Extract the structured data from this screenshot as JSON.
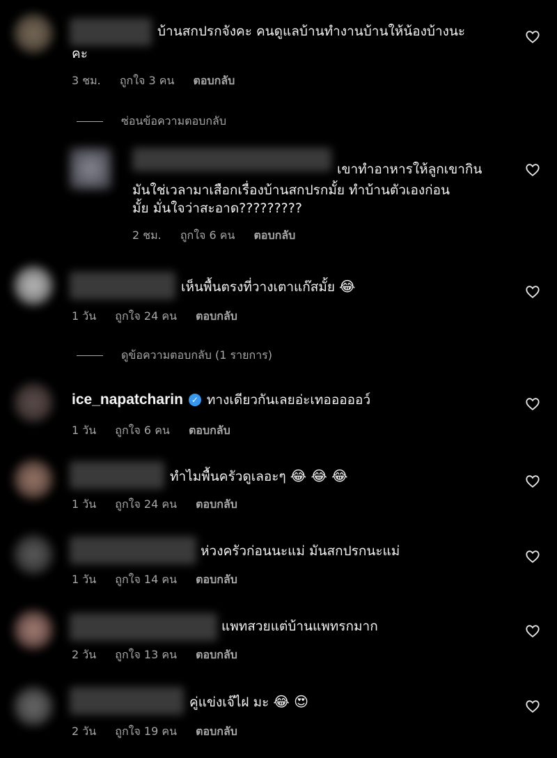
{
  "icons": {
    "heart": "heart-outline-icon",
    "verified": "verified-badge-icon"
  },
  "comments": [
    {
      "text_lines": [
        "บ้านสกปรกจังคะ คนดูแลบ้านทำงานบ้านให้น้องบ้างนะ",
        "คะ"
      ],
      "time": "3 ชม.",
      "likes": "ถูกใจ 3 คน",
      "reply": "ตอบกลับ"
    },
    {
      "text_lines": [
        "เขาทำอาหารให้ลูกเขากิน",
        "มันใช่เวลามาเสือกเรื่องบ้านสกปรกมั้ย ทำบ้านตัวเองก่อน",
        "มั้ย มั่นใจว่าสะอาด?????????"
      ],
      "time": "2 ชม.",
      "likes": "ถูกใจ 6 คน",
      "reply": "ตอบกลับ"
    },
    {
      "text": "เห็นพื้นตรงที่วางเตาแก๊สมั้ย",
      "emoji": "😂",
      "time": "1 วัน",
      "likes": "ถูกใจ 24 คน",
      "reply": "ตอบกลับ"
    },
    {
      "username": "ice_napatcharin",
      "text": "ทางเดียวกันเลยอ่ะเทอออออว์",
      "time": "1 วัน",
      "likes": "ถูกใจ 6 คน",
      "reply": "ตอบกลับ"
    },
    {
      "text": "ทำไมพื้นครัวดูเลอะๆ",
      "emoji": "😂 😂 😂",
      "time": "1 วัน",
      "likes": "ถูกใจ 24 คน",
      "reply": "ตอบกลับ"
    },
    {
      "text": "ห่วงครัวก่อนนะแม่ มันสกปรกนะแม่",
      "time": "1 วัน",
      "likes": "ถูกใจ 14 คน",
      "reply": "ตอบกลับ"
    },
    {
      "text": "แพทสวยแต่บ้านแพทรกมาก",
      "time": "2 วัน",
      "likes": "ถูกใจ 13 คน",
      "reply": "ตอบกลับ"
    },
    {
      "text": "คู่แข่งเจ๊ไฝ มะ",
      "emoji": "😂 😍",
      "time": "2 วัน",
      "likes": "ถูกใจ 19 คน",
      "reply": "ตอบกลับ"
    }
  ],
  "toggles": {
    "hide_replies": "ซ่อนข้อความตอบกลับ",
    "view_replies": "ดูข้อความตอบกลับ (1 รายการ)"
  }
}
